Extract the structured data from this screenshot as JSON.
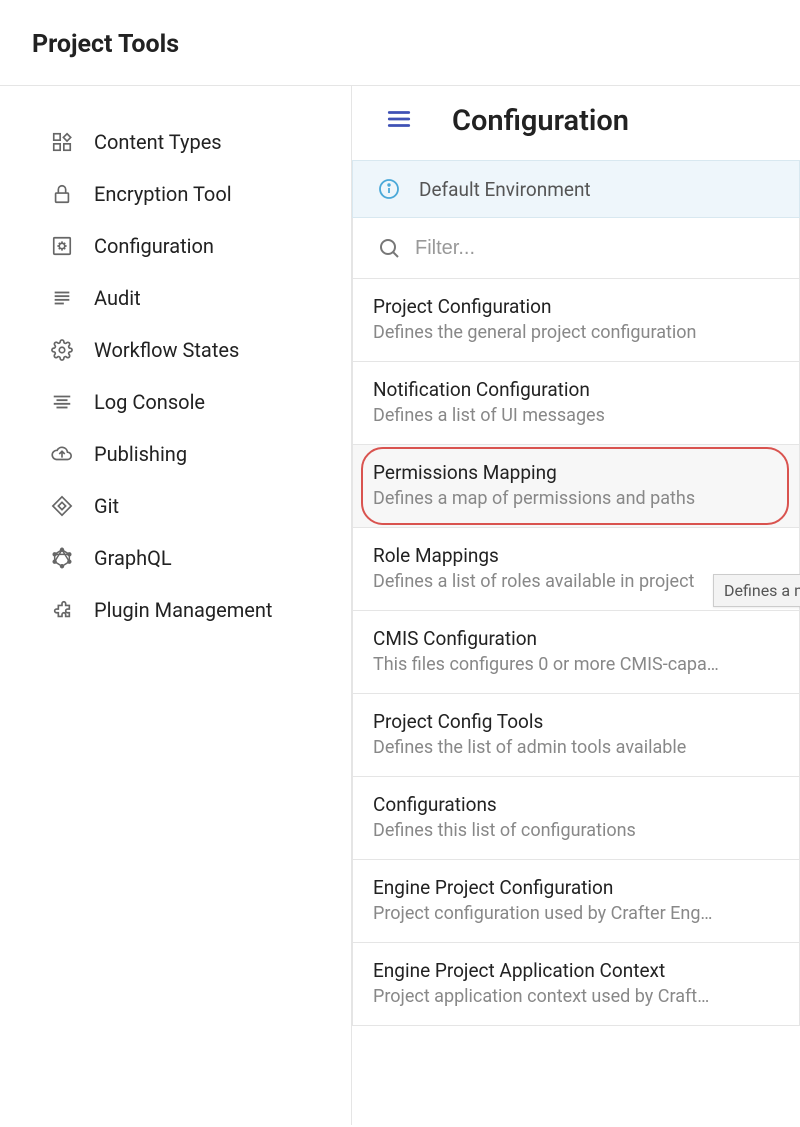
{
  "header": {
    "title": "Project Tools"
  },
  "sidebar": {
    "items": [
      {
        "label": "Content Types",
        "icon": "content-types-icon"
      },
      {
        "label": "Encryption Tool",
        "icon": "lock-icon"
      },
      {
        "label": "Configuration",
        "icon": "gear-box-icon"
      },
      {
        "label": "Audit",
        "icon": "list-icon"
      },
      {
        "label": "Workflow States",
        "icon": "gear-icon"
      },
      {
        "label": "Log Console",
        "icon": "align-icon"
      },
      {
        "label": "Publishing",
        "icon": "cloud-up-icon"
      },
      {
        "label": "Git",
        "icon": "diamond-icon"
      },
      {
        "label": "GraphQL",
        "icon": "graphql-icon"
      },
      {
        "label": "Plugin Management",
        "icon": "extension-icon"
      }
    ]
  },
  "panel": {
    "title": "Configuration",
    "environment_label": "Default Environment",
    "filter_placeholder": "Filter...",
    "tooltip_fragment": "Defines a m",
    "items": [
      {
        "title": "Project Configuration",
        "desc": "Defines the general project configuration",
        "highlighted": false
      },
      {
        "title": "Notification Configuration",
        "desc": "Defines a list of UI messages",
        "highlighted": false
      },
      {
        "title": "Permissions Mapping",
        "desc": "Defines a map of permissions and paths",
        "highlighted": true
      },
      {
        "title": "Role Mappings",
        "desc": "Defines a list of roles available in project",
        "highlighted": false
      },
      {
        "title": "CMIS Configuration",
        "desc": "This files configures 0 or more CMIS-capa…",
        "highlighted": false
      },
      {
        "title": "Project Config Tools",
        "desc": "Defines the list of admin tools available",
        "highlighted": false
      },
      {
        "title": "Configurations",
        "desc": "Defines this list of configurations",
        "highlighted": false
      },
      {
        "title": "Engine Project Configuration",
        "desc": "Project configuration used by Crafter Eng…",
        "highlighted": false
      },
      {
        "title": "Engine Project Application Context",
        "desc": "Project application context used by Craft…",
        "highlighted": false
      }
    ]
  }
}
